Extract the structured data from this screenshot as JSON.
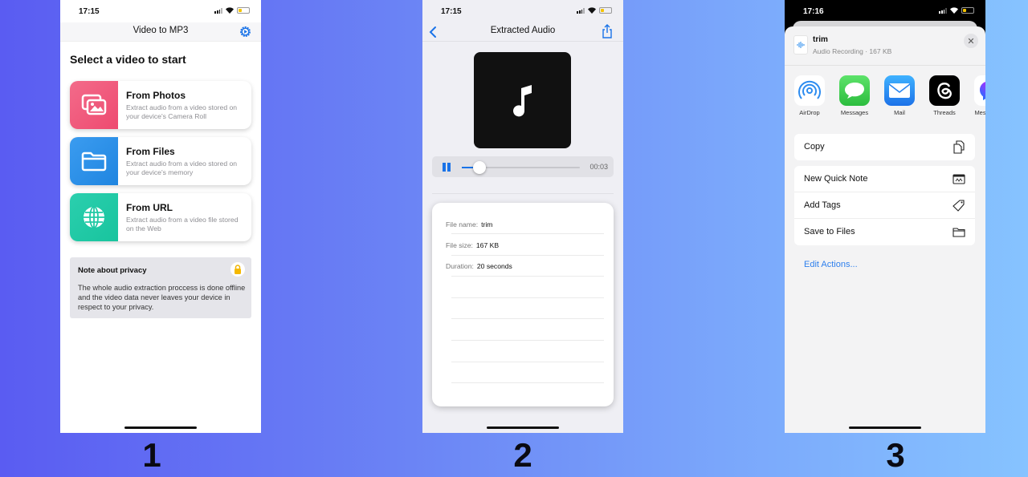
{
  "steps": [
    "1",
    "2",
    "3"
  ],
  "screen1": {
    "status_time": "17:15",
    "nav_title": "Video to MP3",
    "section_title": "Select a video to start",
    "sources": [
      {
        "title": "From Photos",
        "description": "Extract audio from a video stored on your device's Camera Roll",
        "icon": "photos-icon",
        "color": "#f0577a"
      },
      {
        "title": "From Files",
        "description": "Extract audio from a video stored on your device's memory",
        "icon": "folder-icon",
        "color": "#2e8fe8"
      },
      {
        "title": "From URL",
        "description": "Extract audio from a video file stored on the Web",
        "icon": "globe-icon",
        "color": "#20c9a4"
      }
    ],
    "privacy": {
      "title": "Note about privacy",
      "text": "The whole audio extraction proccess is done offline and the video data never leaves your device in respect to your privacy."
    }
  },
  "screen2": {
    "status_time": "17:15",
    "nav_title": "Extracted Audio",
    "player": {
      "elapsed": "00:03",
      "progress": 0.15
    },
    "info": [
      {
        "label": "File name:",
        "value": "trim"
      },
      {
        "label": "File size:",
        "value": "167 KB"
      },
      {
        "label": "Duration:",
        "value": "20 seconds"
      }
    ]
  },
  "screen3": {
    "status_time": "17:16",
    "file": {
      "name": "trim",
      "meta": "Audio Recording · 167 KB"
    },
    "apps": [
      {
        "label": "AirDrop",
        "icon": "airdrop-icon"
      },
      {
        "label": "Messages",
        "icon": "messages-icon"
      },
      {
        "label": "Mail",
        "icon": "mail-icon"
      },
      {
        "label": "Threads",
        "icon": "threads-icon"
      },
      {
        "label": "Messenger",
        "icon": "messenger-icon"
      }
    ],
    "actions_group1": [
      {
        "label": "Copy",
        "icon": "copy-icon"
      }
    ],
    "actions_group2": [
      {
        "label": "New Quick Note",
        "icon": "quick-note-icon"
      },
      {
        "label": "Add Tags",
        "icon": "tag-icon"
      },
      {
        "label": "Save to Files",
        "icon": "folder-icon"
      }
    ],
    "edit_actions": "Edit Actions..."
  },
  "colors": {
    "accent": "#1a73e8",
    "link": "#2f80ed"
  }
}
